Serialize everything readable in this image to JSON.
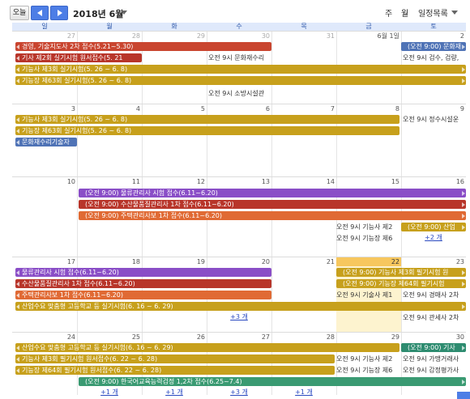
{
  "toolbar": {
    "today_label": "오늘",
    "title": "2018년 6월",
    "view_week": "주",
    "view_month": "월",
    "view_agenda": "일정목록"
  },
  "weekdays": [
    "일",
    "월",
    "화",
    "수",
    "목",
    "금",
    "토"
  ],
  "weeks": [
    {
      "days": [
        "27",
        "28",
        "29",
        "30",
        "31",
        "6월 1일",
        "2"
      ],
      "events": [
        {
          "text": "경영, 기술지도사 2차 접수(5.21~5.30)",
          "color": "red",
          "arrow": "left"
        },
        {
          "text": "(오전 9:00) 문화재",
          "color": "blue"
        },
        {
          "text": "기사 제2회 실기시험 원서접수(5. 21",
          "color": "darkred"
        },
        {
          "text": "오전 9시 문화재수리"
        },
        {
          "text": "오전 9시 검수, 검량,"
        },
        {
          "text": "기능사 제3회 실기시험(5. 26 ~ 6. 8)",
          "color": "gold"
        },
        {
          "text": "기능장 제63회 실기시험(5. 26 ~ 6. 8)",
          "color": "gold"
        },
        {
          "text": "오전 9시 소방시설관"
        }
      ]
    },
    {
      "days": [
        "3",
        "4",
        "5",
        "6",
        "7",
        "8",
        "9"
      ],
      "events": [
        {
          "text": "기능사 제3회 실기시험(5. 26 ~ 6. 8)",
          "color": "gold"
        },
        {
          "text": "오전 9시 정수시설운"
        },
        {
          "text": "기능장 제63회 실기시험(5. 26 ~ 6. 8)",
          "color": "gold"
        },
        {
          "text": "문화재수리기술자",
          "color": "blue"
        }
      ]
    },
    {
      "days": [
        "10",
        "11",
        "12",
        "13",
        "14",
        "15",
        "16"
      ],
      "events": [
        {
          "text": "(오전 9:00) 물류관리사 시험 접수(6.11~6.20)",
          "color": "purple"
        },
        {
          "text": "(오전 9:00) 수산물품질관리사 1차 접수(6.11~6.20)",
          "color": "darkred"
        },
        {
          "text": "(오전 9:00) 주택관리사보 1차 접수(6.11~6.20)",
          "color": "orange"
        },
        {
          "text": "오전 9시 기능사 제2"
        },
        {
          "text": "(오전 9:00) 산업",
          "color": "gold"
        },
        {
          "text": "오전 9시 기능장 제6"
        },
        {
          "text": "+2 개"
        }
      ]
    },
    {
      "days": [
        "17",
        "18",
        "19",
        "20",
        "21",
        "22",
        "23"
      ],
      "events": [
        {
          "text": "물류관리사 시험 접수(6.11~6.20)",
          "color": "purple"
        },
        {
          "text": "(오전 9:00) 기능사 제3회 필기시험 원",
          "color": "gold"
        },
        {
          "text": "수산물품질관리사 1차 접수(6.11~6.20)",
          "color": "darkred"
        },
        {
          "text": "(오전 9:00) 기능장 제64회 필기시험",
          "color": "gold"
        },
        {
          "text": "주택관리사보 1차 접수(6.11~6.20)",
          "color": "orange"
        },
        {
          "text": "오전 9시 기술사 제1"
        },
        {
          "text": "오전 9시 경매사 2차"
        },
        {
          "text": "산업수요 맞춤형 고등학교 등 실기시험(6. 16 ~ 6. 29)",
          "color": "gold"
        },
        {
          "text": "+3 개"
        },
        {
          "text": "오전 9시 관세사 2차"
        }
      ]
    },
    {
      "days": [
        "24",
        "25",
        "26",
        "27",
        "28",
        "29",
        "30"
      ],
      "events": [
        {
          "text": "산업수요 맞춤형 고등학교 등 실기시험(6. 16 ~ 6. 29)",
          "color": "gold"
        },
        {
          "text": "(오전 9:00) 기사 ",
          "color": "green"
        },
        {
          "text": "기능사 제3회 필기시험 원서접수(6. 22 ~ 6. 28)",
          "color": "gold"
        },
        {
          "text": "오전 9시 기능사 제2"
        },
        {
          "text": "오전 9시 가맹거래사"
        },
        {
          "text": "기능장 제64회 필기시험 원서접수(6. 22 ~ 6. 28)",
          "color": "gold"
        },
        {
          "text": "오전 9시 기능장 제6"
        },
        {
          "text": "오전 9시 감정평가사"
        },
        {
          "text": "(오전 9:00) 한국어교육능력검정 1,2차 접수(6.25~7.4)",
          "color": "green2"
        },
        {
          "text": "+1 개"
        },
        {
          "text": "+1 개"
        },
        {
          "text": "+3 개"
        },
        {
          "text": "+1 개"
        }
      ]
    }
  ],
  "colors": {
    "red": "#c9452f",
    "green": "#2e8c70",
    "gold": "#c7a01c",
    "purple": "#8a4ec7",
    "darkred": "#b8352a",
    "orange": "#e06a34",
    "blue": "#4f73b6",
    "green2": "#3a9a72",
    "today": "#fdf3cf",
    "nav": "#4d7ee6"
  }
}
